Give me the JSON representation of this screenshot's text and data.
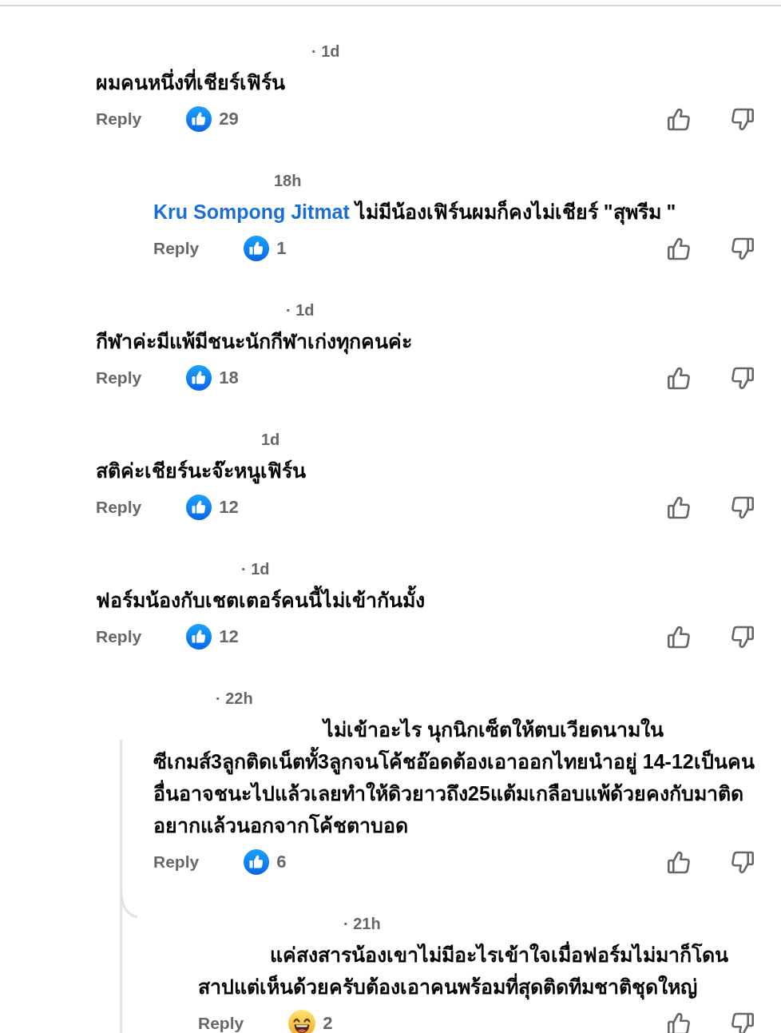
{
  "comments": [
    {
      "time": "· 1d",
      "text": "ผมคนหนึ่งที่เชียร์เฟิร์น",
      "reply_label": "Reply",
      "reaction": {
        "kind": "like",
        "count": "29"
      },
      "children": [
        {
          "time": "18h",
          "mention": "Kru Sompong Jitmat",
          "text": "ไม่มีน้องเฟิร์นผมก็คงไม่เชียร์ \"สุพรีม \"",
          "reply_label": "Reply",
          "reaction": {
            "kind": "like",
            "count": "1"
          }
        }
      ]
    },
    {
      "time": "· 1d",
      "text": "กีฬาค่ะมีแพ้มีชนะนักกีฬาเก่งทุกคนค่ะ",
      "reply_label": "Reply",
      "reaction": {
        "kind": "like",
        "count": "18"
      }
    },
    {
      "time": "1d",
      "text": "สติค่ะเชียร์นะจ๊ะหนูเฟิร์น",
      "reply_label": "Reply",
      "reaction": {
        "kind": "like",
        "count": "12"
      }
    },
    {
      "time": "· 1d",
      "text": "ฟอร์มน้องกับเชตเตอร์คนนี้ไม่เข้ากันมั้ง",
      "reply_label": "Reply",
      "reaction": {
        "kind": "like",
        "count": "12"
      },
      "children": [
        {
          "time": "· 22h",
          "text": "ไม่เข้าอะไร นุกนิกเซ็ตให้ตบเวียดนามในซีเกมส์3ลูกติดเน็ตทั้3ลูกจนโค้ชอ๊อดต้องเอาออกไทยนำอยู่ 14-12เป็นคนอื่นอาจชนะไปแล้วเลยทำให้ดิวยาวถึง25แต้มเกลือบแพ้ด้วยคงกับมาติดอยากแล้วนอกจากโค้ชตาบอด",
          "reply_label": "Reply",
          "reaction": {
            "kind": "like",
            "count": "6"
          },
          "children": [
            {
              "time": "· 21h",
              "text": "แค่สงสารน้องเขาไม่มีอะไรเข้าใจเมื่อฟอร์มไม่มาก็โดนสาปแต่เห็นด้วยครับต้องเอาคนพร้อมที่สุดติดทีมชาติชุดใหญ่",
              "reply_label": "Reply",
              "reaction": {
                "kind": "haha",
                "count": "2"
              }
            }
          ]
        }
      ]
    }
  ]
}
